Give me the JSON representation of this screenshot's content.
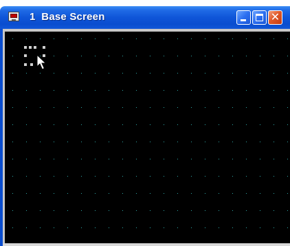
{
  "window": {
    "number": "1",
    "title": "Base Screen"
  },
  "titlebar": {
    "icon": "screen-icon",
    "buttons": [
      {
        "name": "minimize-icon"
      },
      {
        "name": "maximize-icon"
      },
      {
        "name": "close-icon"
      }
    ]
  },
  "canvas": {
    "background": "#000000",
    "grid_color": "#2fa8a8",
    "grid": true
  },
  "selection": {
    "handle_color": "#cfcfcf"
  },
  "cursor": {
    "icon": "arrow-cursor-icon"
  }
}
